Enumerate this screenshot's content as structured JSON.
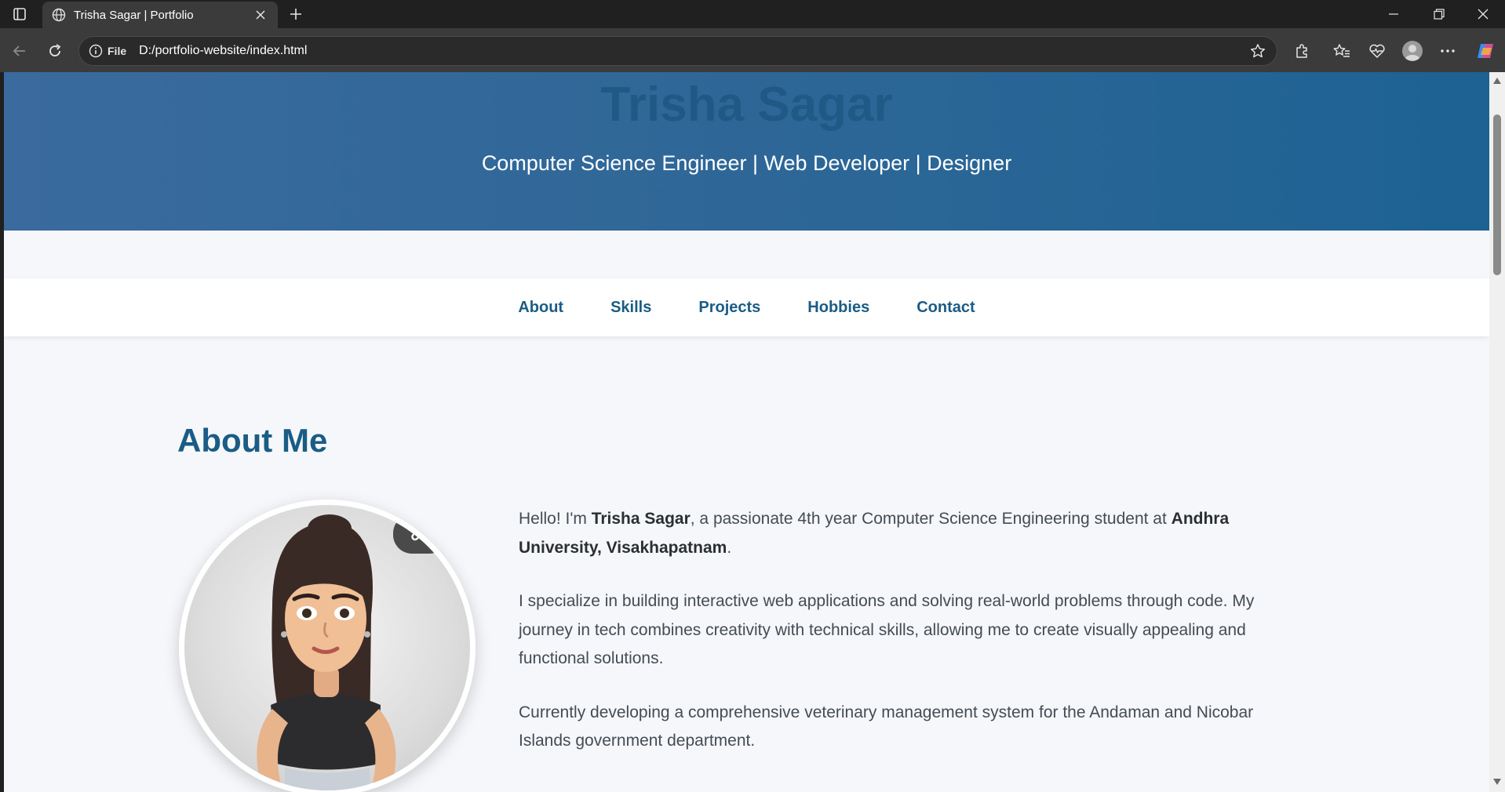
{
  "browser": {
    "tab_title": "Trisha Sagar | Portfolio",
    "site_info_label": "File",
    "url": "D:/portfolio-website/index.html"
  },
  "page": {
    "header": {
      "name": "Trisha Sagar",
      "tagline": "Computer Science Engineer | Web Developer | Designer"
    },
    "nav": {
      "items": [
        {
          "label": "About"
        },
        {
          "label": "Skills"
        },
        {
          "label": "Projects"
        },
        {
          "label": "Hobbies"
        },
        {
          "label": "Contact"
        }
      ]
    },
    "about": {
      "heading": "About Me",
      "p1": {
        "pre": "Hello! I'm ",
        "name": "Trisha Sagar",
        "mid": ", a passionate 4th year Computer Science Engineering student at ",
        "university": "Andhra University, Visakhapatnam",
        "post": "."
      },
      "p2": "I specialize in building interactive web applications and solving real-world problems through code. My journey in tech combines creativity with technical skills, allowing me to create visually appealing and functional solutions.",
      "p3": "Currently developing a comprehensive veterinary management system for the Andaman and Nicobar Islands government department."
    }
  },
  "colors": {
    "accent": "#1a5c85",
    "header_gradient_start": "#3a6a9e",
    "header_gradient_end": "#1d6293",
    "page_bg": "#f5f7fa",
    "chrome_bg": "#3b3b3b"
  },
  "icons": [
    "sidebar-icon",
    "globe-icon",
    "close-icon",
    "plus-icon",
    "minimize-icon",
    "restore-icon",
    "back-icon",
    "reload-icon",
    "info-icon",
    "star-icon",
    "extensions-icon",
    "favorites-icon",
    "health-icon",
    "profile-icon",
    "more-icon",
    "copilot-icon",
    "link-icon"
  ]
}
